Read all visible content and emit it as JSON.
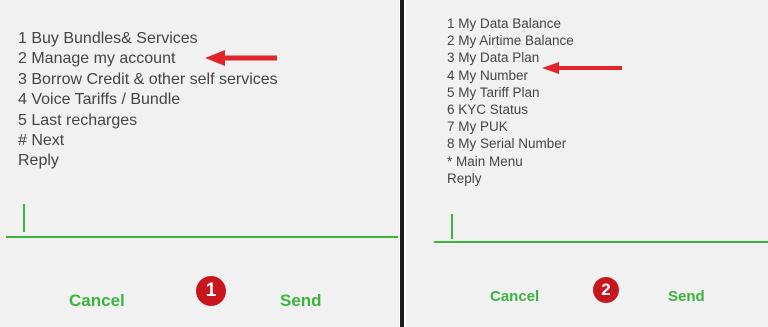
{
  "colors": {
    "panel_bg": "#f1f1f1",
    "menu_text": "#444444",
    "accent_green": "#3cb43c",
    "arrow_red": "#e0262b",
    "badge_red": "#c8161d",
    "divider": "#1d1d1d"
  },
  "left_screen": {
    "menu": [
      "1 Buy Bundles& Services",
      "2 Manage my account",
      "3 Borrow Credit & other self services",
      "4 Voice Tariffs / Bundle",
      "5 Last recharges",
      "# Next",
      "Reply"
    ],
    "cancel_label": "Cancel",
    "send_label": "Send",
    "step_badge": "1",
    "arrow_icon": "arrow-left-icon"
  },
  "right_screen": {
    "menu": [
      "1 My Data Balance",
      "2 My Airtime Balance",
      "3 My Data Plan",
      "4 My Number",
      "5 My Tariff Plan",
      "6 KYC Status",
      "7 My PUK",
      "8 My Serial Number",
      "* Main Menu",
      "Reply"
    ],
    "cancel_label": "Cancel",
    "send_label": "Send",
    "step_badge": "2",
    "arrow_icon": "arrow-left-icon"
  }
}
